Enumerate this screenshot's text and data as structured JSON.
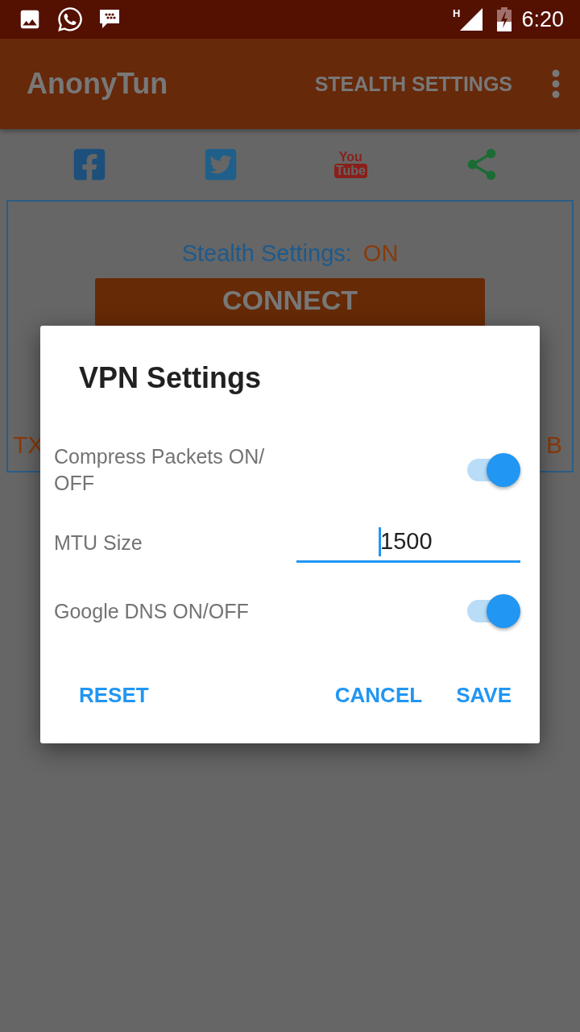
{
  "status_bar": {
    "network_type": "H",
    "time": "6:20"
  },
  "app_bar": {
    "title": "AnonyTun",
    "action": "STEALTH SETTINGS"
  },
  "social_links": [
    {
      "kind": "facebook"
    },
    {
      "kind": "twitter"
    },
    {
      "kind": "youtube",
      "text_top": "You",
      "text_bottom": "Tube"
    },
    {
      "kind": "share"
    }
  ],
  "status_card": {
    "label": "Stealth Settings:",
    "value": "ON",
    "connect_button": "CONNECT",
    "tx_label": "TX",
    "rx_value": "B"
  },
  "dialog": {
    "title": "VPN Settings",
    "settings": [
      {
        "kind": "switch",
        "lines": [
          "Compress Packets ON/",
          "OFF"
        ],
        "on": true
      },
      {
        "kind": "input",
        "lines": [
          "MTU Size"
        ],
        "value": "1500",
        "focused": true
      },
      {
        "kind": "switch",
        "lines": [
          "Google DNS ON/OFF"
        ],
        "on": true
      }
    ],
    "buttons": [
      {
        "label": "RESET"
      },
      {
        "label": "CANCEL"
      },
      {
        "label": "SAVE"
      }
    ]
  }
}
